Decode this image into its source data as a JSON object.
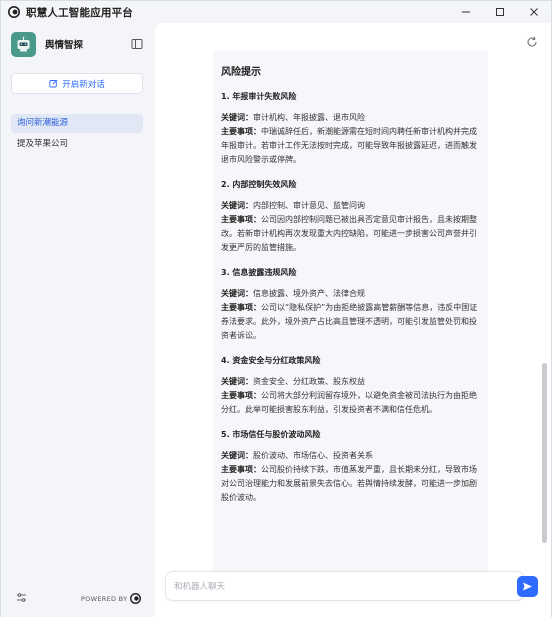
{
  "app": {
    "title": "职慧人工智能应用平台"
  },
  "sidebar": {
    "profile_name": "舆情智探",
    "new_chat_label": "开启新对话",
    "conversations": [
      {
        "label": "询问新潮能源"
      },
      {
        "label": "提及苹果公司"
      }
    ],
    "powered_by": "POWERED BY"
  },
  "main": {
    "heading": "风险提示",
    "risks": [
      {
        "title": "1. 年报审计失败风险",
        "keywords_label": "关键词：",
        "keywords": "审计机构、年报披露、退市风险",
        "events_label": "主要事项：",
        "events": "中瑞诚辞任后，新潮能源需在短时间内聘任新审计机构并完成年报审计。若审计工作无法按时完成，可能导致年报披露延迟，进而触发退市风险警示或停牌。"
      },
      {
        "title": "2. 内部控制失效风险",
        "keywords_label": "关键词：",
        "keywords": "内部控制、审计意见、监管问询",
        "events_label": "主要事项：",
        "events": "公司因内部控制问题已被出具否定意见审计报告，且未按期整改。若新审计机构再次发现重大内控缺陷，可能进一步损害公司声誉并引发更严厉的监管措施。"
      },
      {
        "title": "3. 信息披露违规风险",
        "keywords_label": "关键词：",
        "keywords": "信息披露、境外资产、法律合规",
        "events_label": "主要事项：",
        "events": "公司以“隐私保护”为由拒绝披露高管薪酬等信息，违反中国证券法要求。此外，境外资产占比高且管理不透明，可能引发监管处罚和投资者诉讼。"
      },
      {
        "title": "4. 资金安全与分红政策风险",
        "keywords_label": "关键词：",
        "keywords": "资金安全、分红政策、股东权益",
        "events_label": "主要事项：",
        "events": "公司将大部分利润留存境外，以避免资金被司法执行为由拒绝分红。此举可能损害股东利益，引发投资者不满和信任危机。"
      },
      {
        "title": "5. 市场信任与股价波动风险",
        "keywords_label": "关键词：",
        "keywords": "股价波动、市场信心、投资者关系",
        "events_label": "主要事项：",
        "events": "公司股价持续下跌，市值蒸发严重，且长期未分红，导致市场对公司治理能力和发展前景失去信心。若舆情持续发酵，可能进一步加剧股价波动。"
      }
    ],
    "input_placeholder": "和机器人聊天"
  },
  "colors": {
    "accent": "#2f6bff",
    "avatar": "#4a9a8c",
    "active_item_bg": "#e2e7f5"
  },
  "icons": [
    "app-logo-icon",
    "minimize-icon",
    "maximize-icon",
    "close-icon",
    "sidebar-toggle-icon",
    "new-chat-icon",
    "refresh-icon",
    "settings-icon",
    "send-icon"
  ]
}
